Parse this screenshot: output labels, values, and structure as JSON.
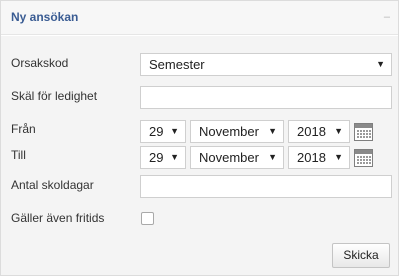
{
  "panel": {
    "title": "Ny ansökan",
    "collapse_symbol": "–"
  },
  "form": {
    "orsakskod": {
      "label": "Orsakskod",
      "value": "Semester"
    },
    "skal": {
      "label": "Skäl för ledighet",
      "value": ""
    },
    "fran": {
      "label": "Från",
      "day": "29",
      "month": "November",
      "year": "2018"
    },
    "till": {
      "label": "Till",
      "day": "29",
      "month": "November",
      "year": "2018"
    },
    "skoldagar": {
      "label": "Antal skoldagar",
      "value": ""
    },
    "fritids": {
      "label": "Gäller även fritids",
      "checked": false
    },
    "submit_label": "Skicka"
  },
  "arrow_symbol": "▼",
  "icons": {
    "calendar": "calendar-icon",
    "collapse": "collapse-icon",
    "dropdown": "chevron-down-icon"
  },
  "colors": {
    "title": "#3a5c93",
    "body_bg": "#f4f4f4",
    "header_bg": "#f7f7f7"
  }
}
